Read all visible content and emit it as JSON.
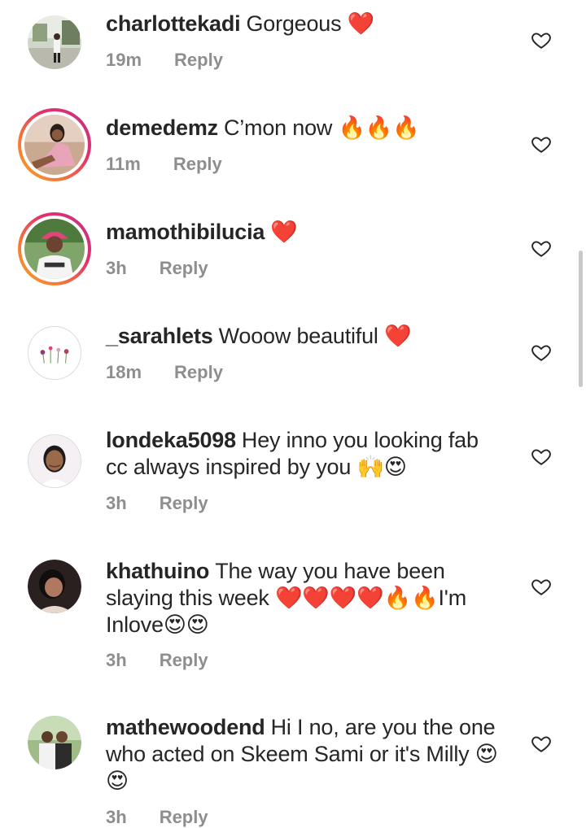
{
  "comments": [
    {
      "username": "charlottekadi",
      "text": "Gorgeous ❤️",
      "time": "19m",
      "reply": "Reply",
      "avatar_ring": false
    },
    {
      "username": "demedemz",
      "text": "C’mon now 🔥🔥🔥",
      "time": "11m",
      "reply": "Reply",
      "avatar_ring": true
    },
    {
      "username": "mamothibilucia",
      "text": "❤️",
      "time": "3h",
      "reply": "Reply",
      "avatar_ring": true
    },
    {
      "username": "_sarahlets",
      "text": "Wooow beautiful ❤️",
      "time": "18m",
      "reply": "Reply",
      "avatar_ring": false
    },
    {
      "username": "londeka5098",
      "text": "Hey inno you looking fab cc always inspired by you 🙌😍",
      "time": "3h",
      "reply": "Reply",
      "avatar_ring": false
    },
    {
      "username": "khathuino",
      "text": "The way you have been slaying this week ❤️❤️❤️❤️🔥🔥I'm Inlove😍😍",
      "time": "3h",
      "reply": "Reply",
      "avatar_ring": false
    },
    {
      "username": "mathewoodend",
      "text": "Hi I no, are you the one who acted on Skeem Sami or it's Milly 😍😍",
      "time": "3h",
      "reply": "Reply",
      "avatar_ring": false
    }
  ],
  "icons": {
    "like": "heart-outline-icon"
  },
  "colors": {
    "text": "#262626",
    "meta": "#8e8e8e",
    "heart": "#e0192c",
    "ring_start": "#f5a623",
    "ring_end": "#c13584"
  }
}
